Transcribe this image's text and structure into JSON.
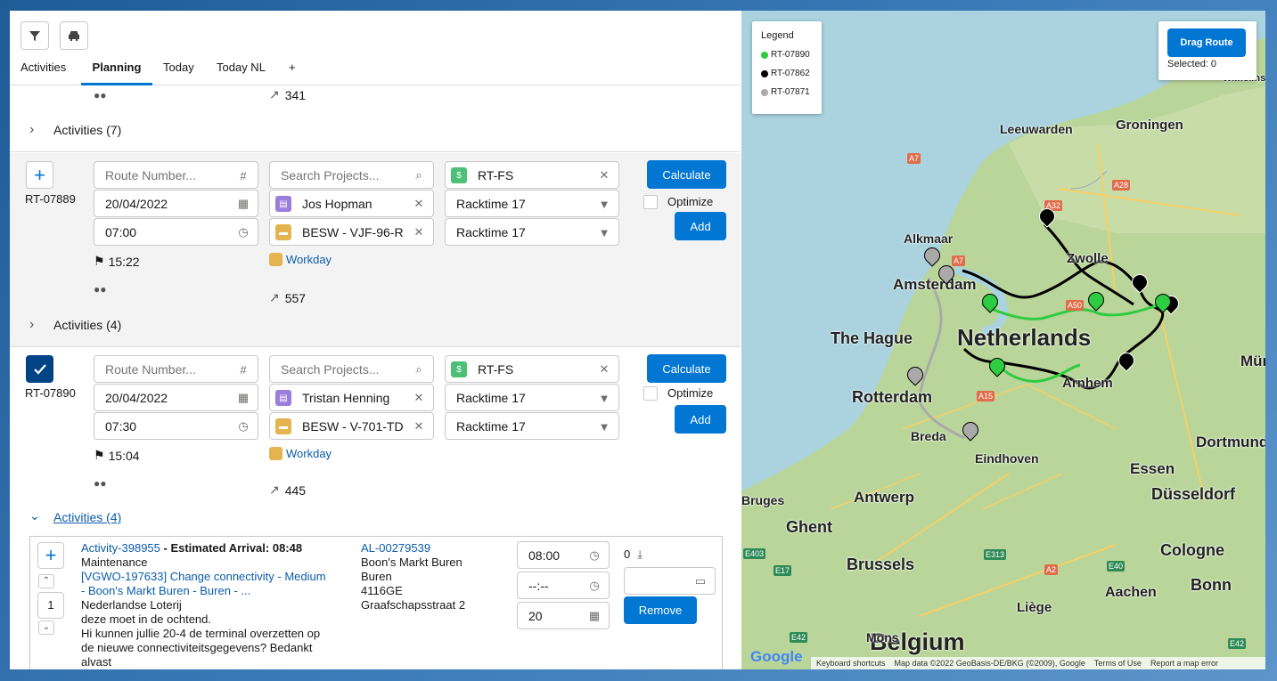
{
  "tabs": [
    {
      "label": "Activities"
    },
    {
      "label": "Planning"
    },
    {
      "label": "Today"
    },
    {
      "label": "Today NL"
    },
    {
      "label": "+"
    }
  ],
  "top_partial": {
    "distance": "341"
  },
  "activities_prev": {
    "label": "Activities (7)"
  },
  "route1": {
    "id": "RT-07889",
    "route_number_placeholder": "Route Number...",
    "date": "20/04/2022",
    "time": "07:00",
    "end_time": "15:22",
    "project_placeholder": "Search Projects...",
    "person": "Jos Hopman",
    "vehicle": "BESW - VJF-96-R ·",
    "calendar_link": "Workday",
    "distance": "557",
    "rt_fs": "RT-FS",
    "rack1": "Racktime 17",
    "rack2": "Racktime 17",
    "calculate": "Calculate",
    "optimize": "Optimize",
    "add": "Add",
    "activities_label": "Activities (4)"
  },
  "route2": {
    "id": "RT-07890",
    "route_number_placeholder": "Route Number...",
    "date": "20/04/2022",
    "time": "07:30",
    "end_time": "15:04",
    "project_placeholder": "Search Projects...",
    "person": "Tristan Henning",
    "vehicle": "BESW - V-701-TD ·",
    "calendar_link": "Workday",
    "distance": "445",
    "rt_fs": "RT-FS",
    "rack1": "Racktime 17",
    "rack2": "Racktime 17",
    "calculate": "Calculate",
    "optimize": "Optimize",
    "add": "Add",
    "activities_label": "Activities (4)"
  },
  "activity": {
    "link": "Activity-398955",
    "est_arrival": " - Estimated Arrival: 08:48",
    "type": "Maintenance",
    "wo_link_1": "[VGWO-197633] Change connectivity - Medium",
    "wo_link_2": "- Boon's Markt Buren - Buren - ...",
    "client": "Nederlandse Loterij",
    "note1": "deze moet in de ochtend.",
    "note2": "Hi kunnen jullie 20-4 de terminal overzetten op",
    "note3": "de nieuwe connectiviteitsgegevens? Bedankt",
    "note4": "alvast",
    "sequence": "1",
    "al_link": "AL-00279539",
    "addr1": "Boon's Markt Buren",
    "addr2": "Buren",
    "addr3": "4116GE",
    "addr4": "Graafschapsstraat 2",
    "time_start": "08:00",
    "time_end": "--:--",
    "duration": "20",
    "count": "0",
    "remove": "Remove"
  },
  "map": {
    "legend_title": "Legend",
    "legend": [
      {
        "label": "RT-07890",
        "color": "#2ecc40"
      },
      {
        "label": "RT-07862",
        "color": "#000000"
      },
      {
        "label": "RT-07871",
        "color": "#aaaaaa"
      }
    ],
    "drag_button": "Drag Route",
    "selected": "Selected: 0",
    "places": [
      "Leeuwarden",
      "Groningen",
      "Alkmaar",
      "Amsterdam",
      "Zwolle",
      "The Hague",
      "Netherlands",
      "Rotterdam",
      "Arnhem",
      "Breda",
      "Eindhoven",
      "Antwerp",
      "Ghent",
      "Brussels",
      "Belgium",
      "Essen",
      "Düsseldorf",
      "Dortmund",
      "Cologne",
      "Bonn",
      "Aachen",
      "Liège",
      "Mons",
      "Müns",
      "Wilhelms",
      "Bruges"
    ],
    "roads": [
      "A7",
      "A28",
      "A32",
      "A7",
      "A50",
      "A15",
      "A2",
      "E40",
      "E17",
      "E313",
      "E42",
      "E403",
      "E42"
    ],
    "footer": [
      "Keyboard shortcuts",
      "Map data ©2022 GeoBasis-DE/BKG (©2009), Google",
      "Terms of Use",
      "Report a map error"
    ],
    "google": "Google"
  }
}
